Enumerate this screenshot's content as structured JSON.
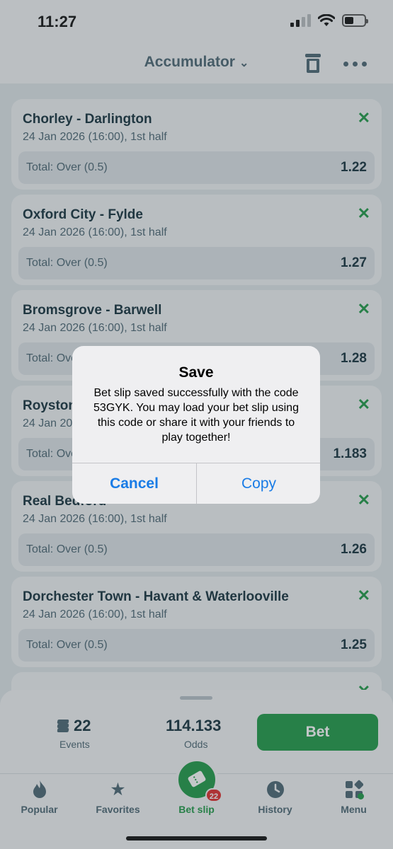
{
  "status_bar": {
    "time": "11:27"
  },
  "header": {
    "title": "Accumulator"
  },
  "bets": [
    {
      "teams": "Chorley - Darlington",
      "date": "24 Jan 2026 (16:00), 1st half",
      "market": "Total: Over (0.5)",
      "odds": "1.22"
    },
    {
      "teams": "Oxford City - Fylde",
      "date": "24 Jan 2026 (16:00), 1st half",
      "market": "Total: Over (0.5)",
      "odds": "1.27"
    },
    {
      "teams": "Bromsgrove - Barwell",
      "date": "24 Jan 2026 (16:00), 1st half",
      "market": "Total: Over (0.5)",
      "odds": "1.28"
    },
    {
      "teams": "Royston",
      "date": "24 Jan 2026 (16:00), 1st half",
      "market": "Total: Over (0.5)",
      "odds": "1.183"
    },
    {
      "teams": "Real Bedford",
      "date": "24 Jan 2026 (16:00), 1st half",
      "market": "Total: Over (0.5)",
      "odds": "1.26"
    },
    {
      "teams": "Dorchester Town - Havant & Waterlooville",
      "date": "24 Jan 2026 (16:00), 1st half",
      "market": "Total: Over (0.5)",
      "odds": "1.25"
    }
  ],
  "summary": {
    "events_count": "22",
    "events_label": "Events",
    "odds_value": "114.133",
    "odds_label": "Odds",
    "bet_button": "Bet"
  },
  "tabs": [
    {
      "label": "Popular",
      "icon": "flame-icon"
    },
    {
      "label": "Favorites",
      "icon": "star-icon"
    },
    {
      "label": "Bet slip",
      "icon": "ticket-icon",
      "badge": "22"
    },
    {
      "label": "History",
      "icon": "clock-icon"
    },
    {
      "label": "Menu",
      "icon": "grid-icon"
    }
  ],
  "dialog": {
    "title": "Save",
    "message": "Bet slip saved successfully with the code 53GYK. You may load your bet slip using this code or share it with your friends to play together!",
    "cancel_label": "Cancel",
    "copy_label": "Copy"
  },
  "colors": {
    "accent_green": "#1f9a47",
    "badge_red": "#e02b2b",
    "dialog_button_blue": "#1a7ce6"
  }
}
